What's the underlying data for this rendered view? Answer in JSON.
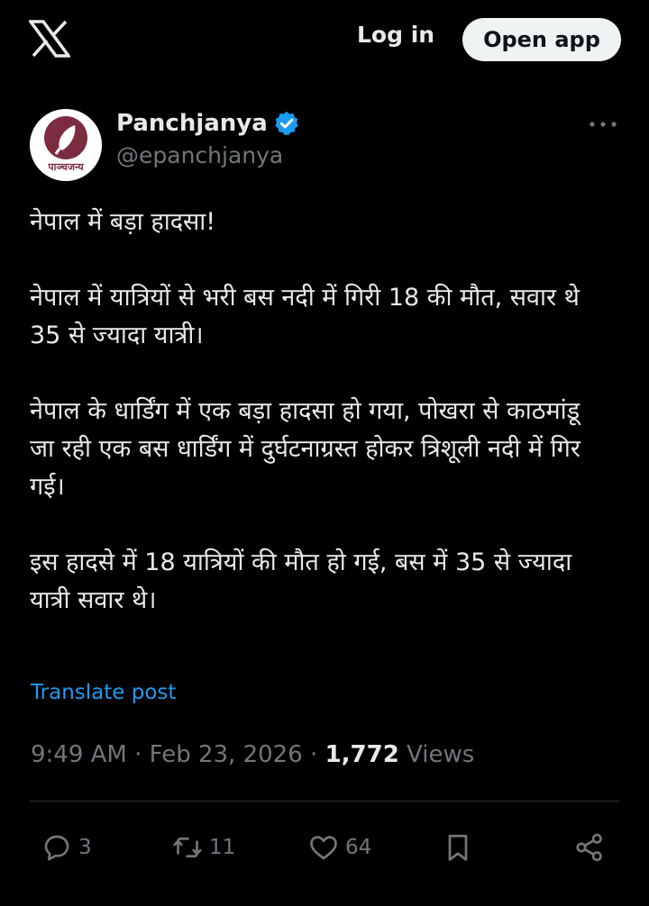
{
  "header": {
    "logo_icon": "x-logo-icon",
    "login_label": "Log in",
    "open_app_label": "Open app"
  },
  "author": {
    "avatar_text": "पाञ्चजन्य",
    "name": "Panchjanya",
    "handle": "@epanchjanya",
    "verified": true,
    "verified_color": "#1d9bf0"
  },
  "tweet": {
    "paragraphs": [
      "नेपाल में बड़ा हादसा!",
      "नेपाल में यात्रियों से भरी बस नदी में गिरी 18 की मौत, सवार थे 35 से ज्यादा यात्री।",
      "नेपाल के धार्डिंग में एक बड़ा हादसा हो गया, पोखरा से काठमांडू जा रही एक बस धार्डिंग में दुर्घटनाग्रस्त होकर त्रिशूली नदी में गिर गई।",
      "इस हादसे में 18 यात्रियों की मौत हो गई, बस में 35 से ज्यादा यात्री सवार थे।"
    ],
    "translate_label": "Translate post",
    "time": "9:49 AM",
    "date": "Feb 23, 2026",
    "views_count": "1,772",
    "views_label": "Views"
  },
  "actions": {
    "replies": "3",
    "reposts": "11",
    "likes": "64"
  },
  "colors": {
    "background": "#000000",
    "text": "#e7e9ea",
    "muted": "#71767b",
    "link": "#1d9bf0",
    "divider": "#2f3336"
  }
}
